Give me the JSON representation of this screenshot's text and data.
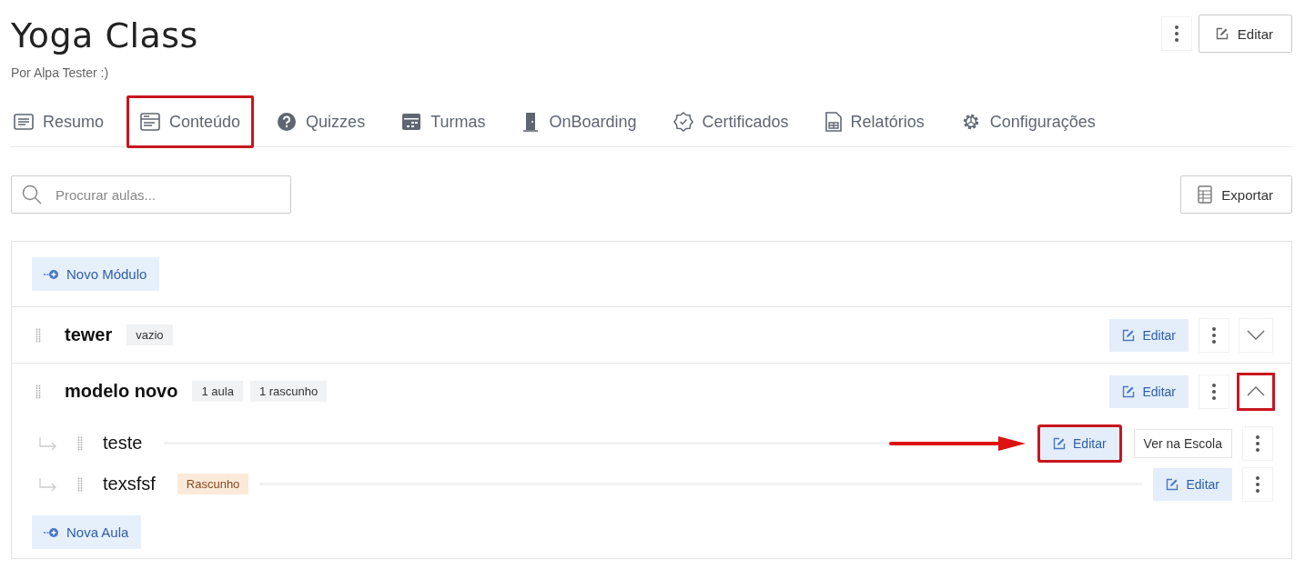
{
  "header": {
    "title": "Yoga Class",
    "subtitle": "Por Alpa Tester :)",
    "edit_button": "Editar"
  },
  "tabs": [
    {
      "label": "Resumo",
      "kind": "list",
      "highlighted": false
    },
    {
      "label": "Conteúdo",
      "kind": "content",
      "highlighted": true
    },
    {
      "label": "Quizzes",
      "kind": "question",
      "highlighted": false
    },
    {
      "label": "Turmas",
      "kind": "calendar",
      "highlighted": false
    },
    {
      "label": "OnBoarding",
      "kind": "door",
      "highlighted": false
    },
    {
      "label": "Certificados",
      "kind": "badge",
      "highlighted": false
    },
    {
      "label": "Relatórios",
      "kind": "sheet",
      "highlighted": false
    },
    {
      "label": "Configurações",
      "kind": "gear",
      "highlighted": false
    }
  ],
  "search": {
    "placeholder": "Procurar aulas..."
  },
  "export_button": "Exportar",
  "new_module_button": "Novo Módulo",
  "modules": [
    {
      "name": "tewer",
      "badges": [
        "vazio"
      ],
      "edit_button": "Editar",
      "expanded": false,
      "highlighted": false
    },
    {
      "name": "modelo novo",
      "badges": [
        "1 aula",
        "1 rascunho"
      ],
      "edit_button": "Editar",
      "expanded": true,
      "highlighted": true,
      "new_lesson_button": "Nova Aula",
      "lessons": [
        {
          "title": "teste",
          "edit_button": "Editar",
          "view_button": "Ver na Escola",
          "highlighted": true
        },
        {
          "title": "texsfsf",
          "badge": "Rascunho",
          "edit_button": "Editar",
          "highlighted": false
        }
      ]
    }
  ]
}
